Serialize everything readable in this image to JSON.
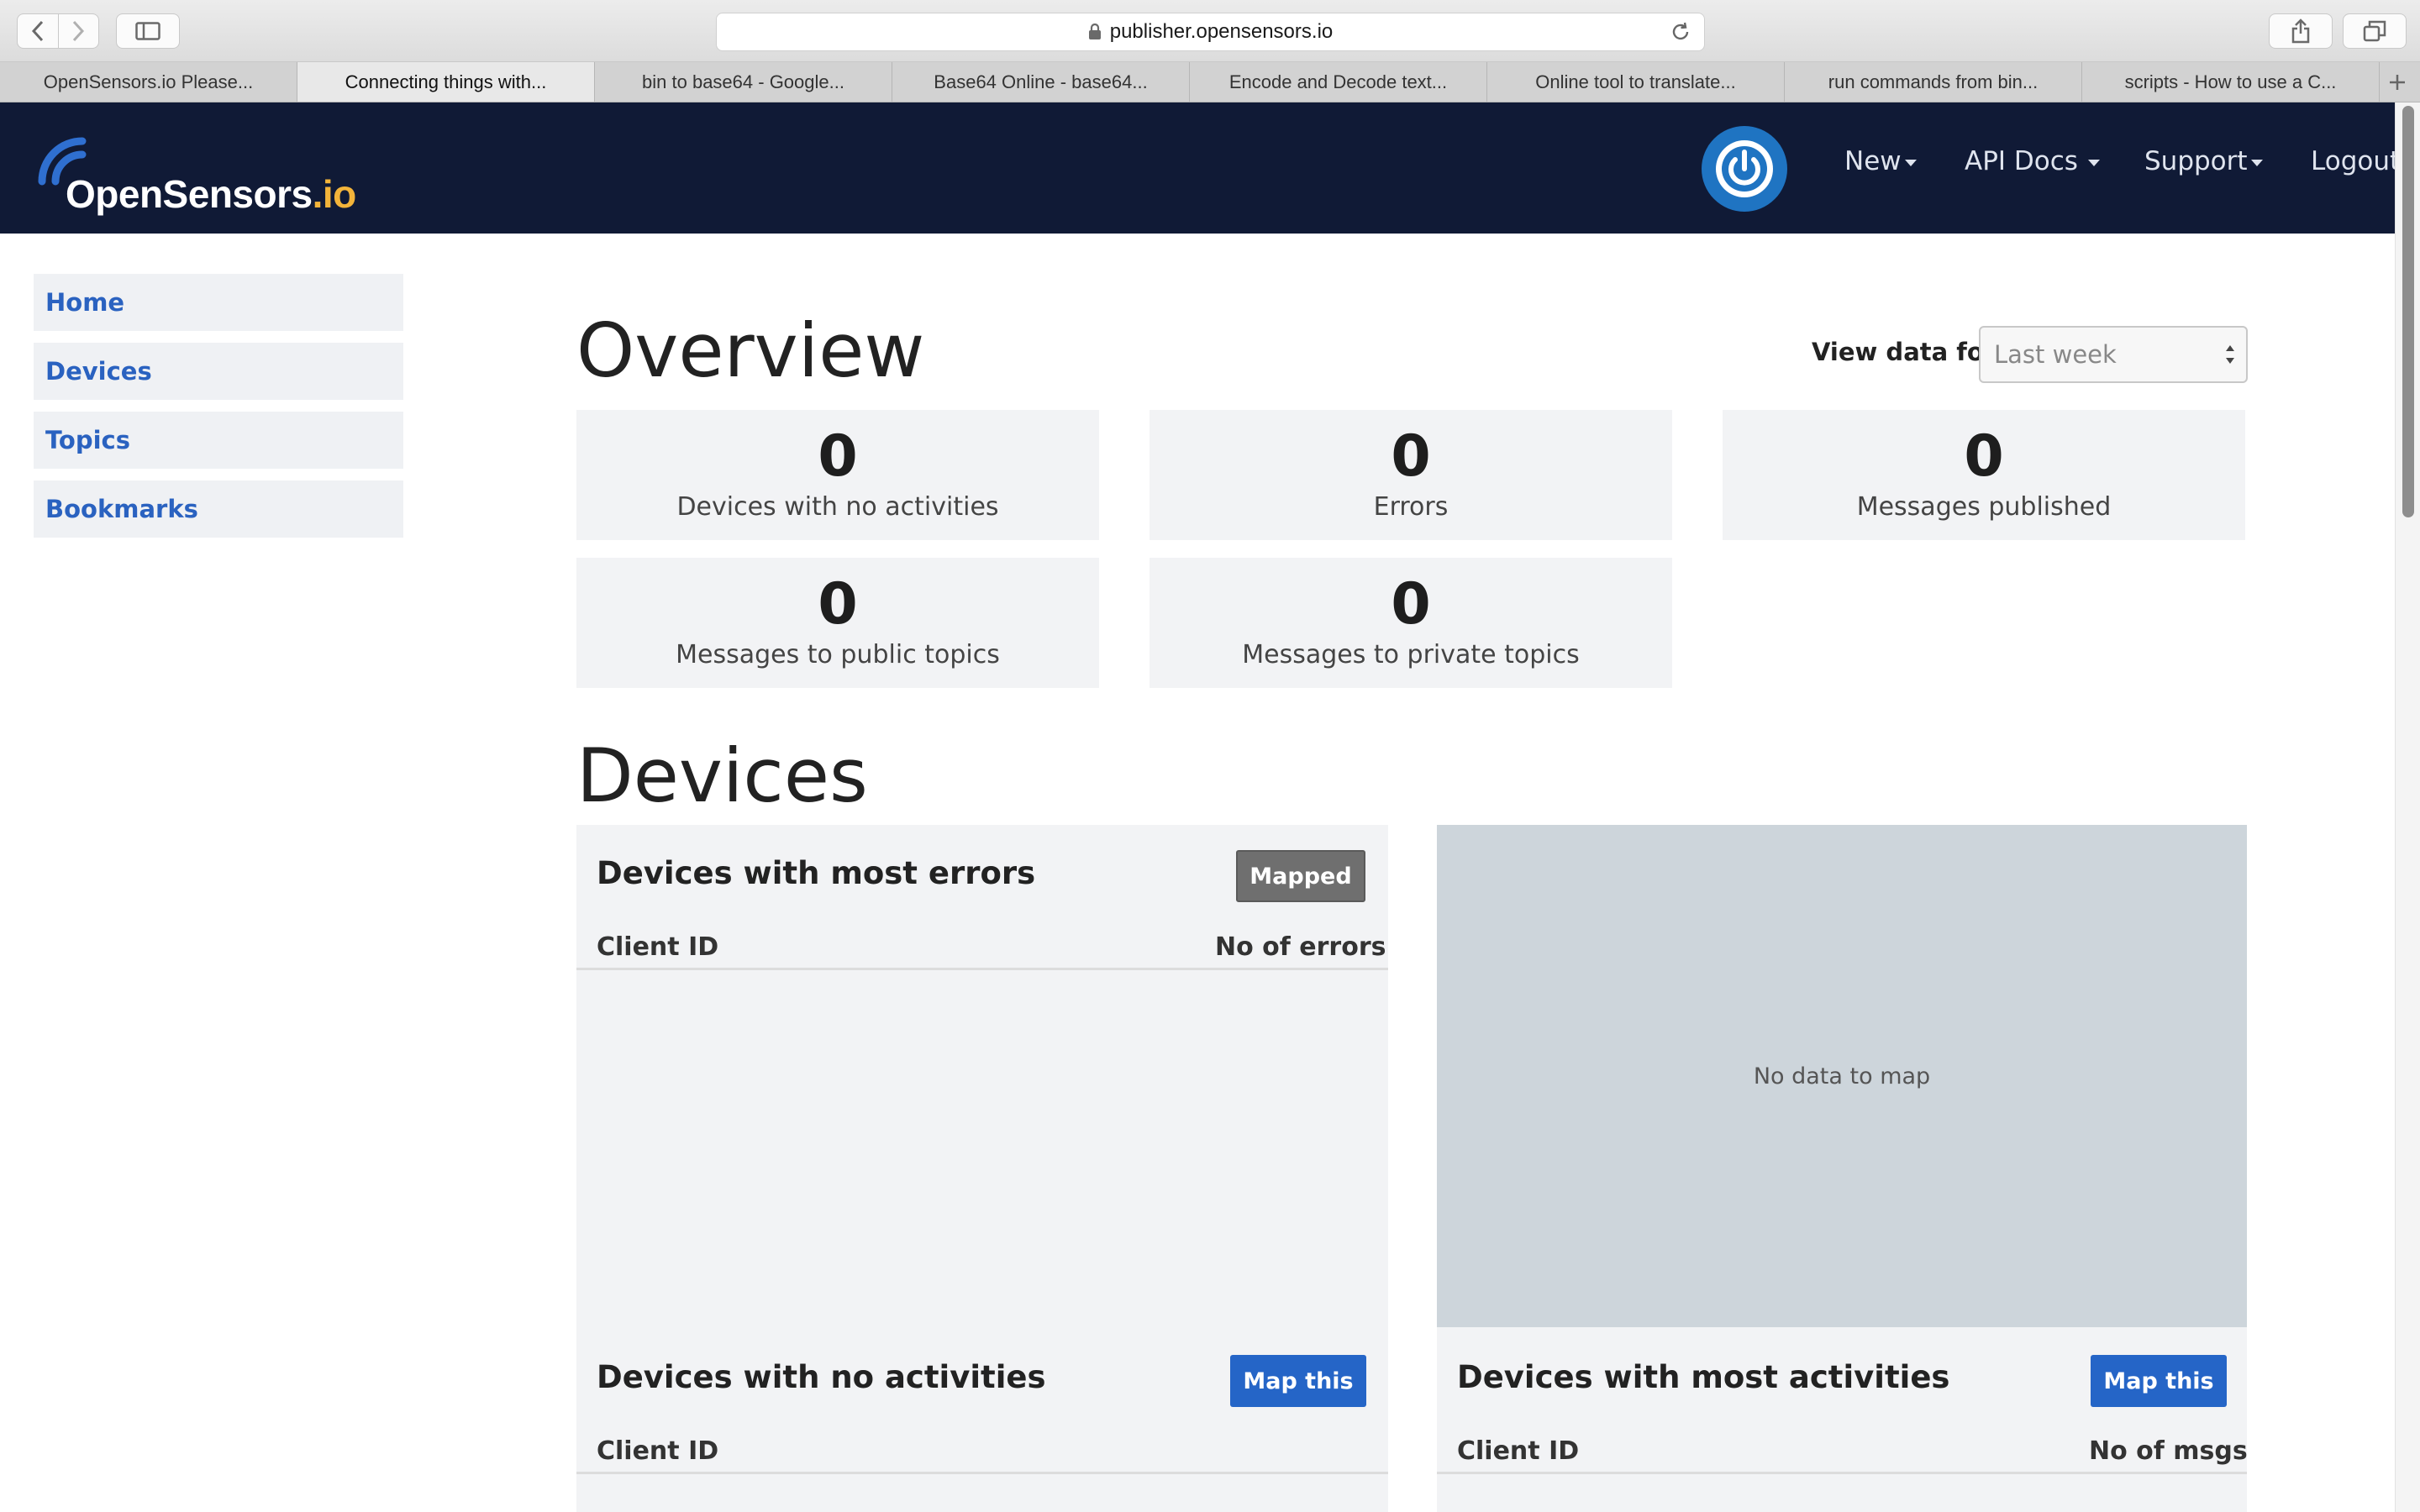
{
  "browser": {
    "url": "publisher.opensensors.io",
    "tabs": [
      "OpenSensors.io Please...",
      "Connecting things with...",
      "bin to base64 - Google...",
      "Base64 Online - base64...",
      "Encode and Decode text...",
      "Online tool to translate...",
      "run commands from bin...",
      "scripts - How to use a C..."
    ],
    "active_tab_index": 1
  },
  "navbar": {
    "logo_main": "OpenSensors",
    "logo_suffix": ".io",
    "menu": [
      "New",
      "API Docs",
      "Support",
      "Logout"
    ],
    "colors": {
      "background": "#101a36",
      "power_button": "#1f74c2",
      "logo_accent": "#f3b43a"
    }
  },
  "sidebar": {
    "items": [
      "Home",
      "Devices",
      "Topics",
      "Bookmarks"
    ]
  },
  "overview": {
    "title": "Overview",
    "view_data_label": "View data for",
    "view_data_value": "Last week",
    "stats": [
      {
        "value": "0",
        "label": "Devices with no activities"
      },
      {
        "value": "0",
        "label": "Errors"
      },
      {
        "value": "0",
        "label": "Messages published"
      },
      {
        "value": "0",
        "label": "Messages to public topics"
      },
      {
        "value": "0",
        "label": "Messages to private topics"
      }
    ]
  },
  "devices": {
    "title": "Devices",
    "most_errors": {
      "title": "Devices with most errors",
      "button": "Mapped",
      "col_client": "Client ID",
      "col_value": "No of errors"
    },
    "map_empty": "No data to map",
    "no_activities": {
      "title": "Devices with no activities",
      "button": "Map this",
      "col_client": "Client ID"
    },
    "most_activities": {
      "title": "Devices with most activities",
      "button": "Map this",
      "col_client": "Client ID",
      "col_value": "No of msgs"
    }
  }
}
